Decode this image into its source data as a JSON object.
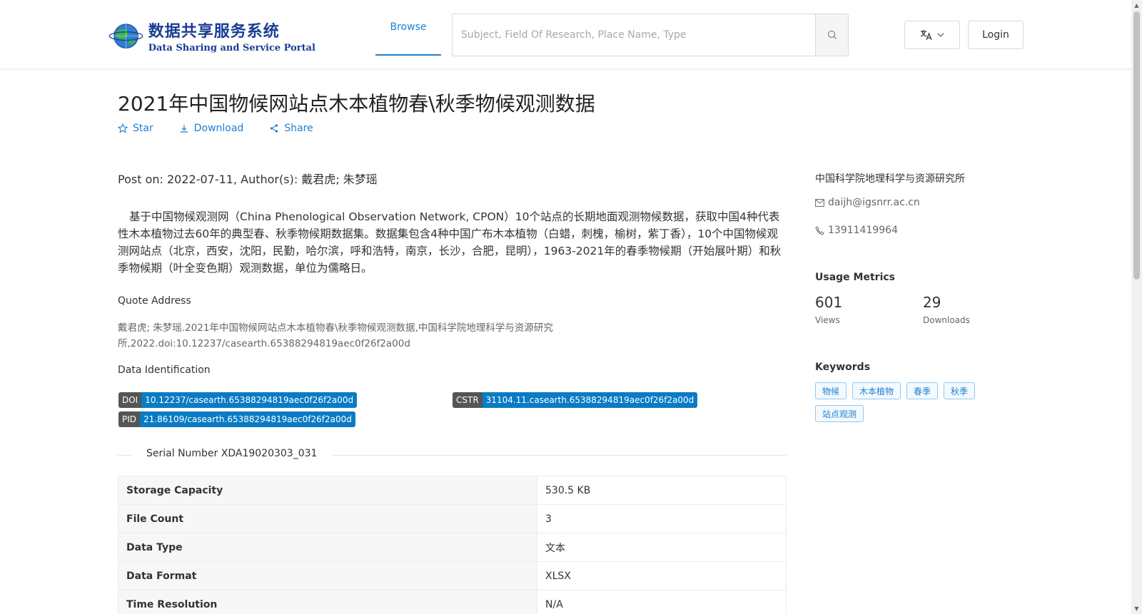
{
  "header": {
    "logo_cn": "数据共享服务系统",
    "logo_en": "Data Sharing and Service Portal",
    "nav_browse": "Browse",
    "search_placeholder": "Subject, Field Of Research, Place Name, Type",
    "login": "Login"
  },
  "dataset": {
    "title": "2021年中国物候网站点木本植物春\\秋季物候观测数据",
    "actions": {
      "star": "Star",
      "download": "Download",
      "share": "Share"
    },
    "post_on": "Post on: 2022-07-11, Author(s): 戴君虎; 朱梦瑶",
    "abstract": "基于中国物候观测网（China Phenological Observation Network, CPON）10个站点的长期地面观测物候数据，获取中国4种代表性木本植物过去60年的典型春、秋季物候期数据集。数据集包含4种中国广布木本植物（白蜡，刺槐，榆树，紫丁香），10个中国物候观测网站点（北京，西安，沈阳，民勤，哈尔滨，呼和浩特，南京，长沙，合肥，昆明），1963-2021年的春季物候期（开始展叶期）和秋季物候期（叶全变色期）观测数据，单位为儒略日。",
    "quote_label": "Quote Address",
    "quote_text": "戴君虎; 朱梦瑶.2021年中国物候网站点木本植物春\\秋季物候观测数据,中国科学院地理科学与资源研究所,2022.doi:10.12237/casearth.65388294819aec0f26f2a00d",
    "identification_label": "Data Identification",
    "identifiers": {
      "doi_key": "DOI",
      "doi_val": "10.12237/casearth.65388294819aec0f26f2a00d",
      "cstr_key": "CSTR",
      "cstr_val": "31104.11.casearth.65388294819aec0f26f2a00d",
      "pid_key": "PID",
      "pid_val": "21.86109/casearth.65388294819aec0f26f2a00d"
    },
    "serial_number": "Serial Number XDA19020303_031",
    "info_rows": [
      {
        "key": "Storage Capacity",
        "value": "530.5 KB"
      },
      {
        "key": "File Count",
        "value": "3"
      },
      {
        "key": "Data Type",
        "value": "文本"
      },
      {
        "key": "Data Format",
        "value": "XLSX"
      },
      {
        "key": "Time Resolution",
        "value": "N/A"
      }
    ]
  },
  "sidebar": {
    "organization": "中国科学院地理科学与资源研究所",
    "email": "daijh@igsnrr.ac.cn",
    "phone": "13911419964",
    "usage_heading": "Usage Metrics",
    "views_num": "601",
    "views_label": "Views",
    "downloads_num": "29",
    "downloads_label": "Downloads",
    "keywords_heading": "Keywords",
    "keywords": [
      "物候",
      "木本植物",
      "春季",
      "秋季",
      "站点观测"
    ]
  },
  "colors": {
    "accent": "#1e7fd1",
    "badge_key": "#555555",
    "badge_value": "#0a7bc4",
    "logo_blue": "#1a3d94"
  },
  "icons": [
    "globe-logo-icon",
    "search-icon",
    "translate-icon",
    "chevron-down-icon",
    "star-icon",
    "download-icon",
    "share-icon",
    "mail-icon",
    "phone-icon"
  ]
}
